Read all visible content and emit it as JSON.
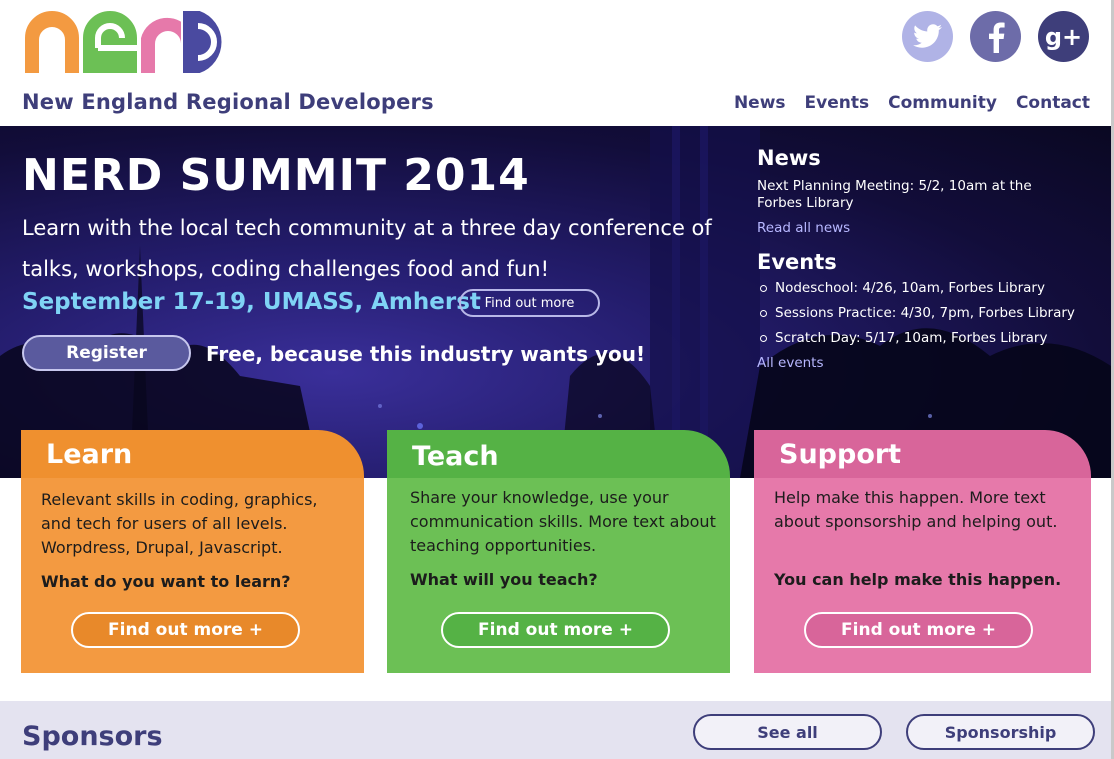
{
  "header": {
    "logo_text": "NERD",
    "site_title": "New England Regional Developers",
    "social": [
      "twitter-icon",
      "facebook-icon",
      "google-plus-icon"
    ],
    "google_plus_glyph": "g+",
    "nav": [
      "News",
      "Events",
      "Community",
      "Contact"
    ]
  },
  "hero": {
    "title": "NERD SUMMIT 2014",
    "description": "Learn with the local tech community at a three day conference of talks, workshops, coding challenges food and fun!",
    "date": "September 17-19, UMASS, Amherst",
    "find_out_more": "Find out more",
    "register": "Register",
    "free_text": "Free, because this industry wants you!"
  },
  "sidebar": {
    "news_title": "News",
    "news_item": "Next Planning Meeting: 5/2, 10am at the Forbes Library",
    "news_link": "Read all news",
    "events_title": "Events",
    "events": [
      "Nodeschool: 4/26, 10am, Forbes Library",
      "Sessions Practice: 4/30, 7pm, Forbes Library",
      "Scratch Day: 5/17,  10am, Forbes Library"
    ],
    "events_link": "All events"
  },
  "cards": {
    "learn": {
      "title": "Learn",
      "description": "Relevant skills in coding, graphics, and tech for users of all levels. Worpdress, Drupal, Javascript.",
      "question": "What do you want to learn?",
      "button": "Find out more +"
    },
    "teach": {
      "title": "Teach",
      "description": "Share your knowledge, use your communication skills. More text about teaching opportunities.",
      "question": "What will you teach?",
      "button": "Find out more +"
    },
    "support": {
      "title": "Support",
      "description": "Help make this happen. More text about sponsorship and helping out.",
      "question": "You can help make this happen.",
      "button": "Find out more +"
    }
  },
  "sponsors": {
    "title": "Sponsors",
    "see_all": "See all",
    "sponsorship": "Sponsorship"
  },
  "colors": {
    "brand_navy": "#3e3e7a",
    "learn_orange": "#f39a41",
    "teach_green": "#6cc055",
    "support_pink": "#e679aa",
    "hero_date_blue": "#7fd3f5"
  }
}
